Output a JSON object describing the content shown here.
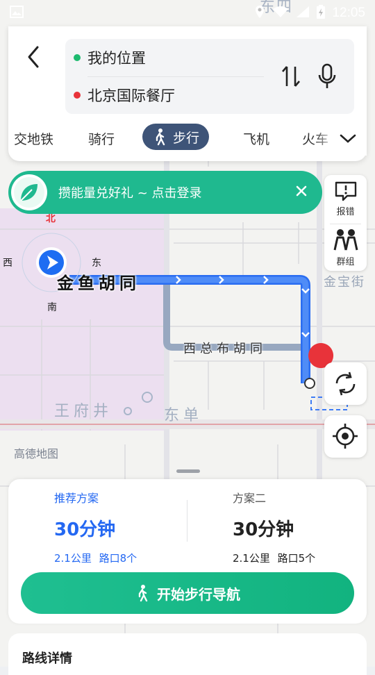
{
  "status_bar": {
    "time": "12:05"
  },
  "route": {
    "origin": "我的位置",
    "destination": "北京国际餐厅",
    "origin_color": "#1dba6f",
    "destination_color": "#e8333a"
  },
  "modes": [
    {
      "label": "交地铁",
      "active": false
    },
    {
      "label": "骑行",
      "active": false
    },
    {
      "label": "步行",
      "active": true
    },
    {
      "label": "飞机",
      "active": false
    },
    {
      "label": "火车",
      "active": false
    }
  ],
  "banner": {
    "text": "攒能量兑好礼 ~ 点击登录",
    "color": "#1fb98f"
  },
  "tools": {
    "report_label": "报错",
    "group_label": "群组"
  },
  "map": {
    "street_main": "金鱼胡同",
    "street_alt": "西总布胡同",
    "street_east": "金宝街",
    "district_1": "王府井",
    "district_2": "东单",
    "compass_n": "北",
    "compass_w": "西",
    "compass_e": "东",
    "compass_s": "南",
    "top_label": "东四",
    "watermark": "高德地图",
    "route_color": "#3d7bf5"
  },
  "plans": [
    {
      "label": "推荐方案",
      "time": "30分钟",
      "distance": "2.1公里",
      "crossings": "路口8个",
      "selected": true
    },
    {
      "label": "方案二",
      "time": "30分钟",
      "distance": "2.1公里",
      "crossings": "路口5个",
      "selected": false
    }
  ],
  "start_button": "开始步行导航",
  "details_title": "路线详情",
  "accent_color": "#2468f2"
}
